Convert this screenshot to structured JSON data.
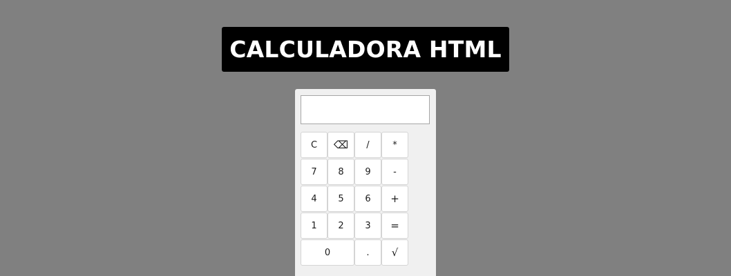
{
  "header": {
    "title": "CALCULADORA HTML"
  },
  "display": {
    "value": ""
  },
  "keys": {
    "clear": "C",
    "backspace": "⌫",
    "divide": "/",
    "multiply": "*",
    "seven": "7",
    "eight": "8",
    "nine": "9",
    "minus": "-",
    "four": "4",
    "five": "5",
    "six": "6",
    "plus": "+",
    "one": "1",
    "two": "2",
    "three": "3",
    "equals": "=",
    "zero": "0",
    "decimal": ".",
    "sqrt": "√"
  },
  "colors": {
    "page_background": "#808080",
    "banner_background": "#000000",
    "banner_text": "#ffffff",
    "calculator_background": "#f0f0f0",
    "key_background": "#ffffff"
  }
}
